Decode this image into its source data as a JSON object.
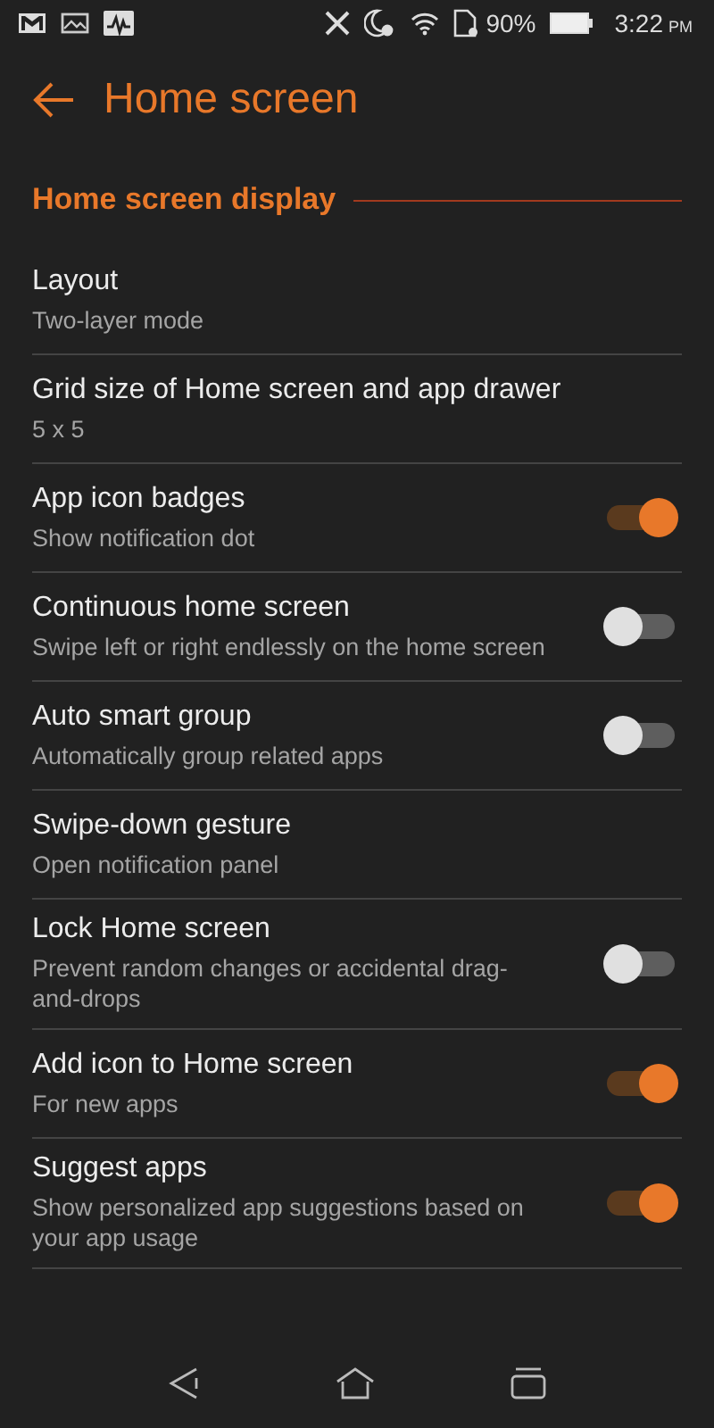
{
  "status_bar": {
    "battery_percent": "90%",
    "time": "3:22",
    "time_suffix": "PM"
  },
  "header": {
    "title": "Home screen"
  },
  "section": {
    "title": "Home screen display"
  },
  "settings": [
    {
      "kind": "text",
      "title": "Layout",
      "subtitle": "Two-layer mode"
    },
    {
      "kind": "text",
      "title": "Grid size of Home screen and app drawer",
      "subtitle": "5 x 5"
    },
    {
      "kind": "switch",
      "title": "App icon badges",
      "subtitle": "Show notification dot",
      "on": true
    },
    {
      "kind": "switch",
      "title": "Continuous home screen",
      "subtitle": "Swipe left or right endlessly on the home screen",
      "on": false
    },
    {
      "kind": "switch",
      "title": "Auto smart group",
      "subtitle": "Automatically group related apps",
      "on": false
    },
    {
      "kind": "text",
      "title": "Swipe-down gesture",
      "subtitle": "Open notification panel"
    },
    {
      "kind": "switch",
      "title": "Lock Home screen",
      "subtitle": "Prevent random changes or accidental drag-and-drops",
      "on": false
    },
    {
      "kind": "switch",
      "title": "Add icon to Home screen",
      "subtitle": "For new apps",
      "on": true
    },
    {
      "kind": "switch",
      "title": "Suggest apps",
      "subtitle": "Show personalized app suggestions based on your app usage",
      "on": true
    }
  ]
}
